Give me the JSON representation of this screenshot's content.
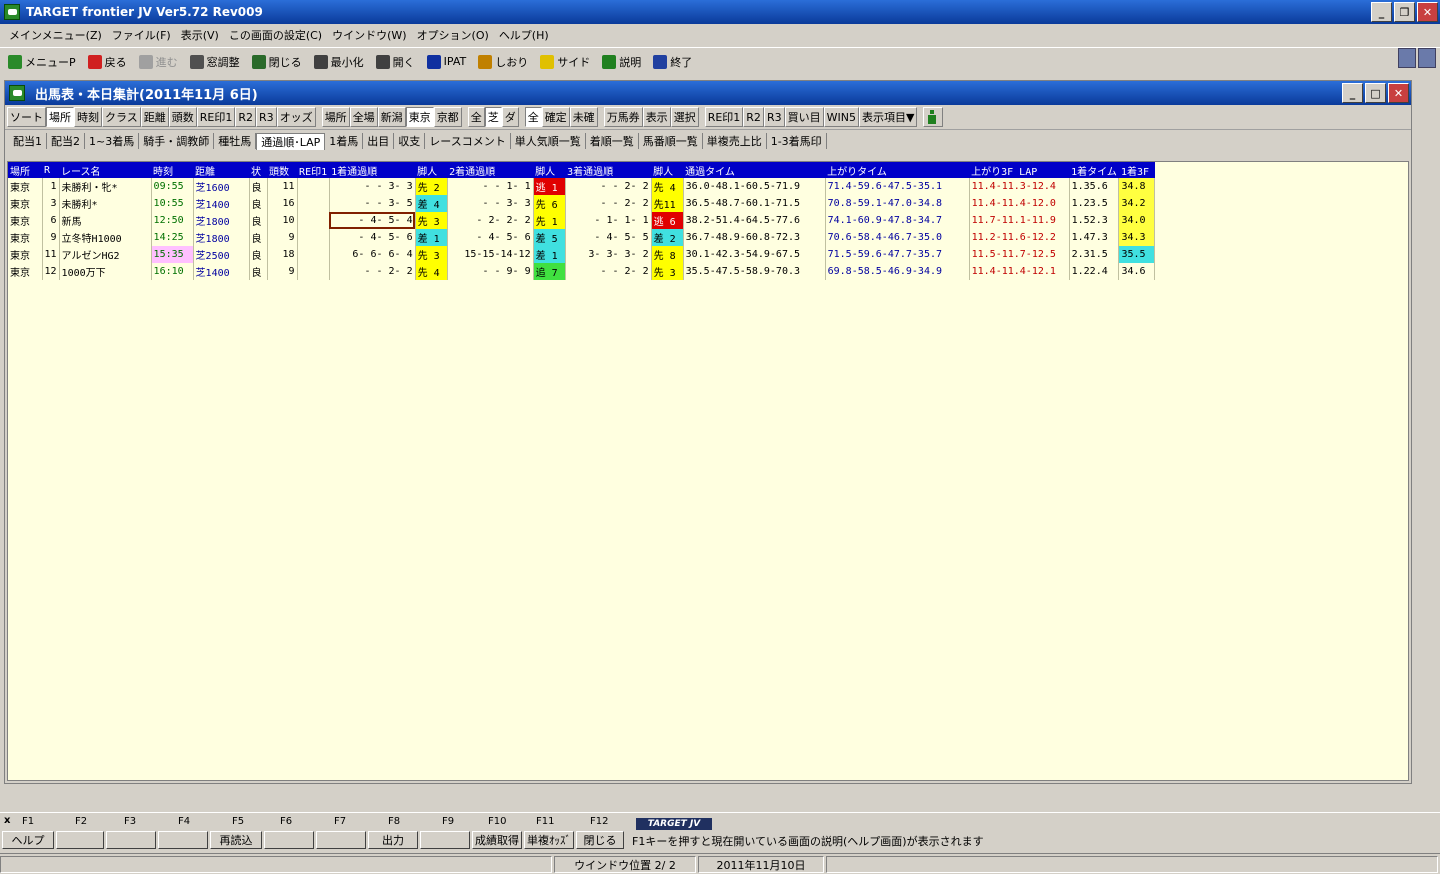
{
  "app": {
    "title": "TARGET frontier JV  Ver5.72  Rev009"
  },
  "menu": [
    "メインメニュー(Z)",
    "ファイル(F)",
    "表示(V)",
    "この画面の設定(C)",
    "ウインドウ(W)",
    "オプション(O)",
    "ヘルプ(H)"
  ],
  "toolbar": [
    {
      "label": "メニューP",
      "icon": "menu-icon"
    },
    {
      "label": "戻る",
      "icon": "back-arrow-icon"
    },
    {
      "label": "進む",
      "icon": "forward-arrow-icon",
      "disabled": true
    },
    {
      "label": "窓調整",
      "icon": "window-adjust-icon"
    },
    {
      "label": "閉じる",
      "icon": "close-window-icon"
    },
    {
      "label": "最小化",
      "icon": "minimize-icon"
    },
    {
      "label": "開く",
      "icon": "open-icon"
    },
    {
      "label": "IPAT",
      "icon": "pat-icon"
    },
    {
      "label": "しおり",
      "icon": "bookmark-icon"
    },
    {
      "label": "サイド",
      "icon": "side-icon"
    },
    {
      "label": "説明",
      "icon": "help-icon"
    },
    {
      "label": "終了",
      "icon": "exit-icon"
    }
  ],
  "child": {
    "title": "出馬表・本日集計(2011年11月 6日)"
  },
  "row1": [
    "ソート",
    "場所",
    "時刻",
    "クラス",
    "距離",
    "頭数",
    "RE印1",
    "R2",
    "R3",
    "オッズ",
    "|",
    "場所",
    "全場",
    "新潟",
    "東京",
    "京都",
    "|",
    "全",
    "芝",
    "ダ",
    "|",
    "全",
    "確定",
    "未確",
    "|",
    "万馬券",
    "表示",
    "選択",
    "|",
    "RE印1",
    "R2",
    "R3",
    "買い目",
    "WIN5",
    "表示項目▼"
  ],
  "row1_active": [
    "場所",
    "東京",
    "芝",
    "全"
  ],
  "row2": [
    "配当1",
    "配当2",
    "1~3着馬",
    "騎手・調教師",
    "種牡馬",
    "通過順･LAP",
    "1着馬",
    "出目",
    "収支",
    "レースコメント",
    "単人気順一覧",
    "着順一覧",
    "馬番順一覧",
    "単複売上比",
    "1-3着馬印"
  ],
  "row2_active": "通過順･LAP",
  "table": {
    "headers": [
      "場所",
      "R",
      "レース名",
      "時刻",
      "距離",
      "状",
      "頭数",
      "RE印1",
      "1着通過順",
      "脚人",
      "2着通過順",
      "脚人",
      "3着通過順",
      "脚人",
      "通過タイム",
      "上がりタイム",
      "上がり3F LAP",
      "1着タイム",
      "1着3F"
    ],
    "rows": [
      {
        "place": "東京",
        "r": "1",
        "name": "未勝利・牝*",
        "time": "09:55",
        "dist": "芝1600",
        "cond": "良",
        "cnt": "11",
        "ref": "",
        "p1": "-  - 3- 3",
        "l1": "先 2",
        "l1c": "y",
        "p2": "-  - 1- 1",
        "l2": "逃 1",
        "l2c": "r",
        "p3": "-  - 2- 2",
        "l3": "先 4",
        "l3c": "y",
        "pace": "36.0-48.1-60.5-71.9",
        "up": "71.4-59.6-47.5-35.1",
        "lap": "11.4-11.3-12.4",
        "t1": "1.35.6",
        "f3": "34.8",
        "f3c": "y"
      },
      {
        "place": "東京",
        "r": "3",
        "name": "未勝利*",
        "time": "10:55",
        "dist": "芝1400",
        "cond": "良",
        "cnt": "16",
        "ref": "",
        "p1": "-  - 3- 5",
        "l1": "差 4",
        "l1c": "c",
        "p2": "-  - 3- 3",
        "l2": "先 6",
        "l2c": "y",
        "p3": "-  - 2- 2",
        "l3": "先11",
        "l3c": "y",
        "pace": "36.5-48.7-60.1-71.5",
        "up": "70.8-59.1-47.0-34.8",
        "lap": "11.4-11.4-12.0",
        "t1": "1.23.5",
        "f3": "34.2",
        "f3c": "y"
      },
      {
        "place": "東京",
        "r": "6",
        "name": "新馬",
        "time": "12:50",
        "dist": "芝1800",
        "cond": "良",
        "cnt": "10",
        "ref": "",
        "p1": "- 4- 5- 4",
        "l1": "先 3",
        "l1c": "y",
        "p2": "- 2- 2- 2",
        "l2": "先 1",
        "l2c": "y",
        "p3": "- 1- 1- 1",
        "l3": "逃 6",
        "l3c": "r",
        "pace": "38.2-51.4-64.5-77.6",
        "up": "74.1-60.9-47.8-34.7",
        "lap": "11.7-11.1-11.9",
        "t1": "1.52.3",
        "f3": "34.0",
        "f3c": "y",
        "sel": true
      },
      {
        "place": "東京",
        "r": "9",
        "name": "立冬特H1000",
        "time": "14:25",
        "dist": "芝1800",
        "cond": "良",
        "cnt": "9",
        "ref": "",
        "p1": "- 4- 5- 6",
        "l1": "差 1",
        "l1c": "c",
        "p2": "- 4- 5- 6",
        "l2": "差 5",
        "l2c": "c",
        "p3": "- 4- 5- 5",
        "l3": "差 2",
        "l3c": "c",
        "pace": "36.7-48.9-60.8-72.3",
        "up": "70.6-58.4-46.7-35.0",
        "lap": "11.2-11.6-12.2",
        "t1": "1.47.3",
        "f3": "34.3",
        "f3c": "y"
      },
      {
        "place": "東京",
        "r": "11",
        "name": "アルゼンHG2",
        "time": "15:35",
        "timePink": true,
        "dist": "芝2500",
        "cond": "良",
        "cnt": "18",
        "ref": "",
        "p1": "6- 6- 6- 4",
        "l1": "先 3",
        "l1c": "y",
        "p2": "15-15-14-12",
        "l2": "差 1",
        "l2c": "c",
        "p3": "3- 3- 3- 2",
        "l3": "先 8",
        "l3c": "y",
        "pace": "30.1-42.3-54.9-67.5",
        "up": "71.5-59.6-47.7-35.7",
        "lap": "11.5-11.7-12.5",
        "t1": "2.31.5",
        "f3": "35.5",
        "f3c": "c"
      },
      {
        "place": "東京",
        "r": "12",
        "name": "1000万下",
        "time": "16:10",
        "dist": "芝1400",
        "cond": "良",
        "cnt": "9",
        "ref": "",
        "p1": "-  - 2- 2",
        "l1": "先 4",
        "l1c": "y",
        "p2": "-  - 9- 9",
        "l2": "追 7",
        "l2c": "g",
        "p3": "-  - 2- 2",
        "l3": "先 3",
        "l3c": "y",
        "pace": "35.5-47.5-58.9-70.3",
        "up": "69.8-58.5-46.9-34.9",
        "lap": "11.4-11.4-12.1",
        "t1": "1.22.4",
        "f3": "34.6",
        "f3c": ""
      }
    ]
  },
  "fkeys": {
    "nums": [
      "F1",
      "F2",
      "F3",
      "F4",
      "F5",
      "F6",
      "F7",
      "F8",
      "F9",
      "F10",
      "F11",
      "F12"
    ],
    "labels": [
      "ヘルプ",
      "",
      "",
      "",
      "再読込",
      "",
      "",
      "出力",
      "",
      "成績取得",
      "単複ｵｯｽﾞ",
      "閉じる"
    ],
    "x_mark": "x",
    "logo": "TARGET JV",
    "help": "F1キーを押すと現在開いている画面の説明(ヘルプ画面)が表示されます"
  },
  "status": {
    "window_pos": "ウインドウ位置 2/ 2",
    "date": "2011年11月10日"
  }
}
